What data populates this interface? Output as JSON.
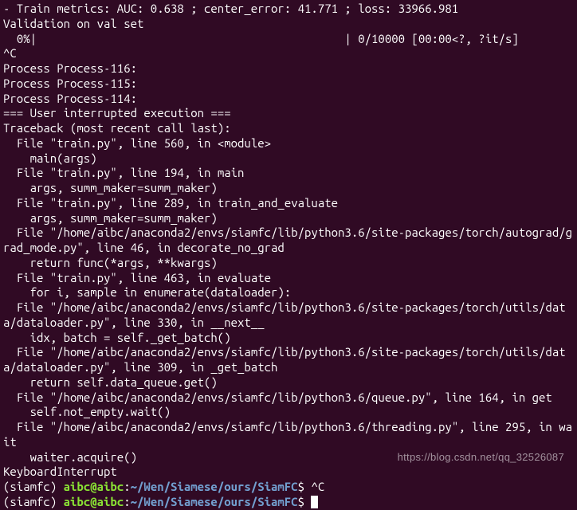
{
  "lines": [
    "- Train metrics: AUC: 0.638 ; center_error: 41.771 ; loss: 33966.981",
    "Validation on val set",
    "  0%|                                              | 0/10000 [00:00<?, ?it/s]",
    "^C",
    "Process Process-116:",
    "Process Process-115:",
    "Process Process-114:",
    "=== User interrupted execution ===",
    "Traceback (most recent call last):",
    "  File \"train.py\", line 560, in <module>",
    "    main(args)",
    "  File \"train.py\", line 194, in main",
    "    args, summ_maker=summ_maker)",
    "  File \"train.py\", line 289, in train_and_evaluate",
    "    args, summ_maker=summ_maker)",
    "  File \"/home/aibc/anaconda2/envs/siamfc/lib/python3.6/site-packages/torch/autograd/grad_mode.py\", line 46, in decorate_no_grad",
    "    return func(*args, **kwargs)",
    "  File \"train.py\", line 463, in evaluate",
    "    for i, sample in enumerate(dataloader):",
    "  File \"/home/aibc/anaconda2/envs/siamfc/lib/python3.6/site-packages/torch/utils/data/dataloader.py\", line 330, in __next__",
    "    idx, batch = self._get_batch()",
    "  File \"/home/aibc/anaconda2/envs/siamfc/lib/python3.6/site-packages/torch/utils/data/dataloader.py\", line 309, in _get_batch",
    "    return self.data_queue.get()",
    "  File \"/home/aibc/anaconda2/envs/siamfc/lib/python3.6/queue.py\", line 164, in get",
    "    self.not_empty.wait()",
    "  File \"/home/aibc/anaconda2/envs/siamfc/lib/python3.6/threading.py\", line 295, in wait",
    "    waiter.acquire()",
    "KeyboardInterrupt"
  ],
  "prompt1": {
    "env": "(siamfc) ",
    "user": "aibc@aibc",
    "colon": ":",
    "path": "~/Wen/Siamese/ours/SiamFC",
    "dollar": "$ ",
    "cmd": "^C"
  },
  "prompt2": {
    "env": "(siamfc) ",
    "user": "aibc@aibc",
    "colon": ":",
    "path": "~/Wen/Siamese/ours/SiamFC",
    "dollar": "$ "
  },
  "watermark": "https://blog.csdn.net/qq_32526087"
}
